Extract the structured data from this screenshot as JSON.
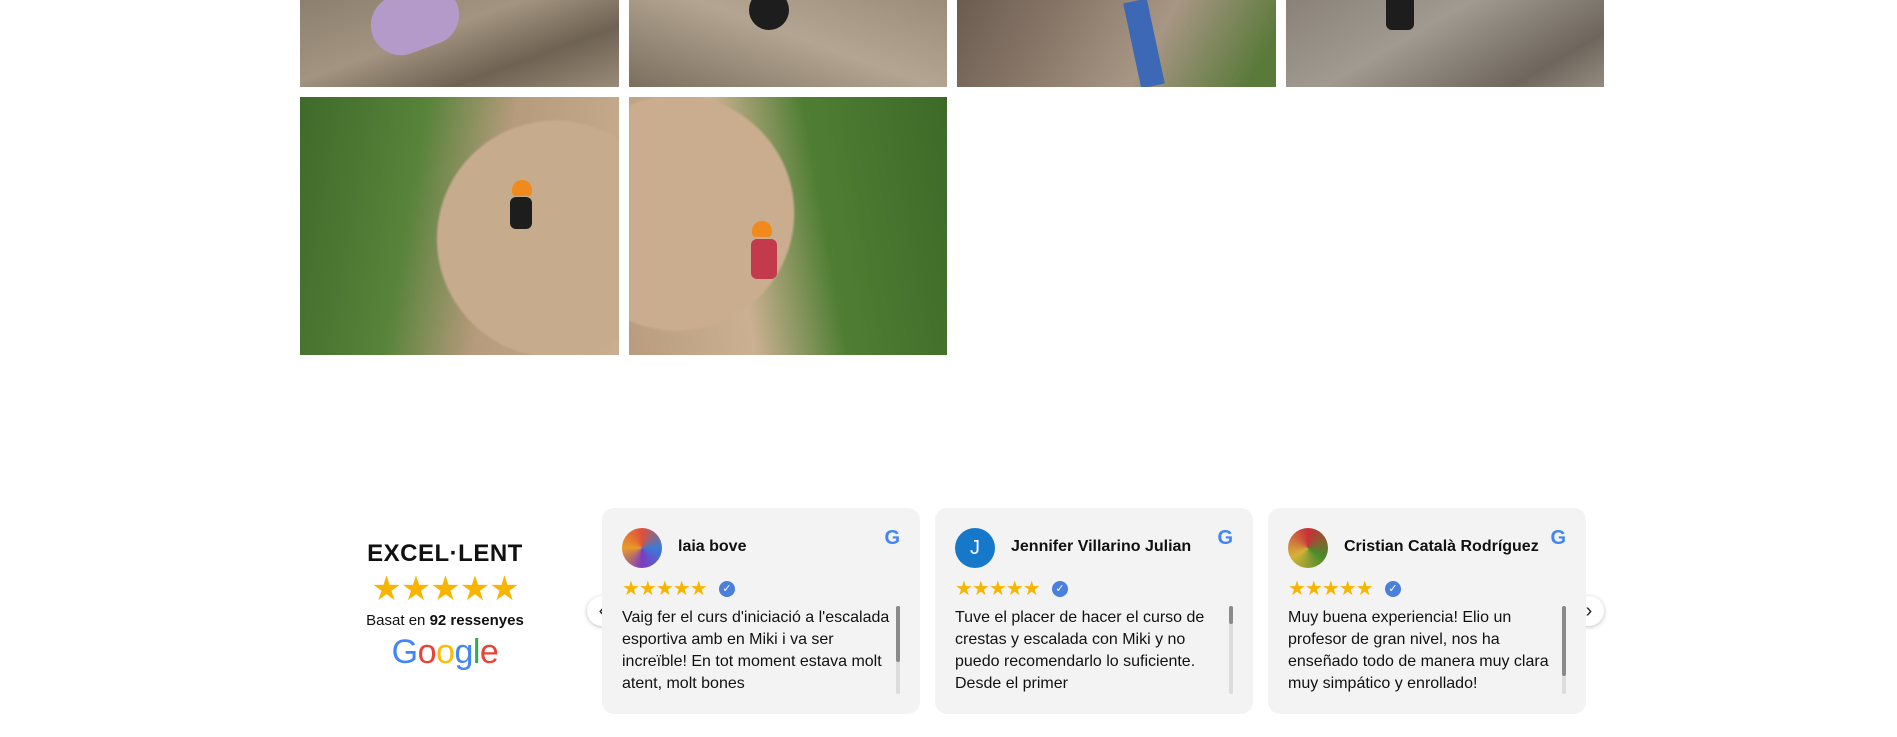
{
  "gallery": {
    "photos": [
      {
        "icon": "climbing-photo"
      },
      {
        "icon": "climbing-photo"
      },
      {
        "icon": "climbing-photo"
      },
      {
        "icon": "climbing-photo"
      },
      {
        "icon": "climbing-photo"
      },
      {
        "icon": "climbing-photo"
      }
    ]
  },
  "summary": {
    "rating_label": "EXCEL·LENT",
    "stars": "★★★★★",
    "based_prefix": "Basat en",
    "count": "92 ressenyes",
    "brand": [
      "G",
      "o",
      "o",
      "g",
      "l",
      "e"
    ],
    "brand_colors": [
      "#4285F4",
      "#EA4335",
      "#FBBC05",
      "#4285F4",
      "#34A853",
      "#EA4335"
    ]
  },
  "reviews": [
    {
      "name": "laia bove",
      "avatar": "",
      "stars": "★★★★★",
      "verified": "✓",
      "text": "Vaig fer el curs d'iniciació a l'escalada esportiva amb en Miki i va ser increïble! En tot moment estava molt atent, molt bones"
    },
    {
      "name": "Jennifer Villarino Julian",
      "avatar": "J",
      "stars": "★★★★★",
      "verified": "✓",
      "text": "Tuve el placer de hacer el curso de crestas y escalada con Miki y no puedo recomendarlo lo suficiente. Desde el primer"
    },
    {
      "name": "Cristian Català Rodríguez",
      "avatar": "",
      "stars": "★★★★★",
      "verified": "✓",
      "text": "Muy buena experiencia! Elio un profesor de gran nivel, nos ha enseñado todo de manera muy clara muy simpático y enrollado!"
    }
  ],
  "google_icon": "G",
  "google_icon_color": "#4285F4",
  "nav": {
    "prev": "‹",
    "next": "›"
  },
  "colors": {
    "star": "#f7b500",
    "card_bg": "#f3f3f3",
    "verified": "#4a7fdc"
  }
}
